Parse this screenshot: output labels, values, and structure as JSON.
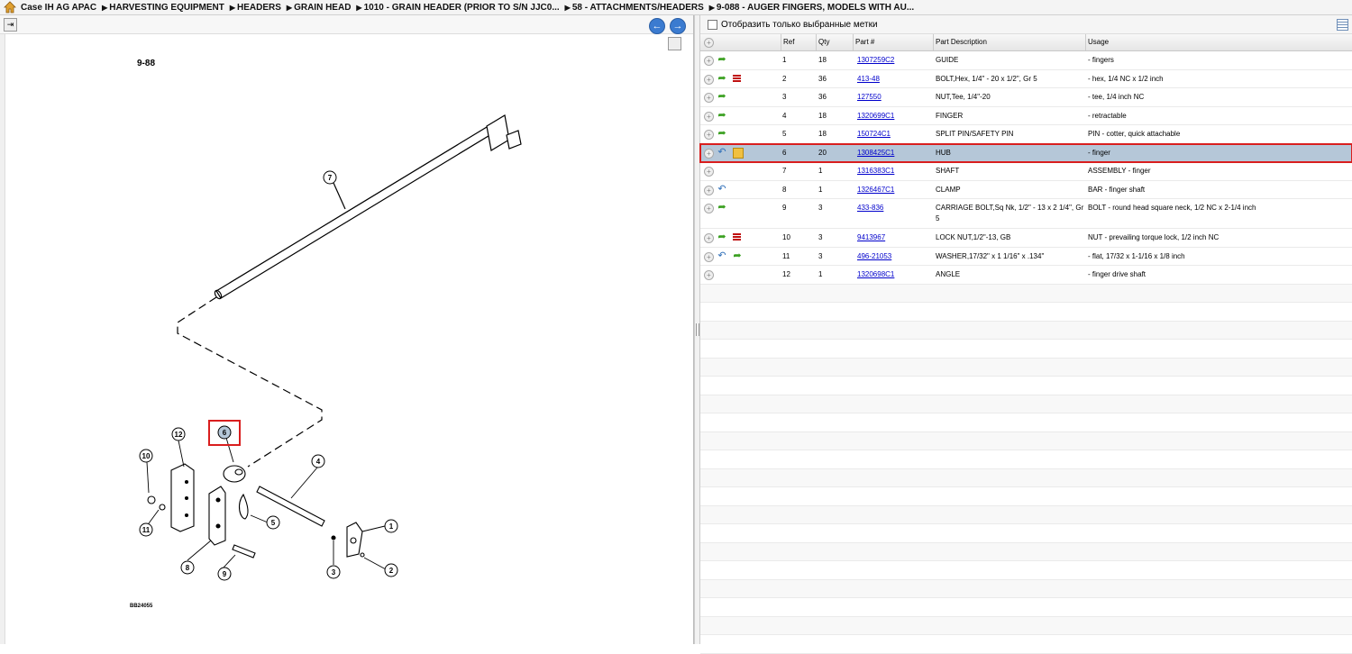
{
  "breadcrumb": {
    "home_icon": "home-icon",
    "items": [
      "Case IH AG APAC",
      "HARVESTING EQUIPMENT",
      "HEADERS",
      "GRAIN HEAD",
      "1010 - GRAIN HEADER (PRIOR TO S/N JJC0...",
      "58 - ATTACHMENTS/HEADERS",
      "9-088 - AUGER FINGERS, MODELS WITH AU..."
    ]
  },
  "diagram": {
    "page_label": "9-88",
    "footer_code": "BB24055",
    "callouts": [
      "1",
      "2",
      "3",
      "4",
      "5",
      "6",
      "7",
      "8",
      "9",
      "10",
      "11",
      "12"
    ],
    "selected_callout": "6",
    "nav": {
      "back": "back-arrow-icon",
      "forward": "forward-arrow-icon"
    }
  },
  "filter": {
    "label": "Отобразить только выбранные метки"
  },
  "table": {
    "headers": {
      "ref": "Ref",
      "qty": "Qty",
      "part": "Part #",
      "desc": "Part Description",
      "usage": "Usage"
    },
    "rows": [
      {
        "ref": "1",
        "qty": "18",
        "part": "1307259C2",
        "desc": "GUIDE",
        "usage": "- fingers",
        "icons": [
          "green-arrow"
        ]
      },
      {
        "ref": "2",
        "qty": "36",
        "part": "413-48",
        "desc": "BOLT,Hex, 1/4\" - 20 x 1/2\", Gr 5",
        "usage": "- hex, 1/4 NC x 1/2 inch",
        "icons": [
          "green-arrow",
          "red-list"
        ]
      },
      {
        "ref": "3",
        "qty": "36",
        "part": "127550",
        "desc": "NUT,Tee, 1/4\"-20",
        "usage": "- tee, 1/4 inch NC",
        "icons": [
          "green-arrow"
        ]
      },
      {
        "ref": "4",
        "qty": "18",
        "part": "1320699C1",
        "desc": "FINGER",
        "usage": "- retractable",
        "icons": [
          "green-arrow"
        ]
      },
      {
        "ref": "5",
        "qty": "18",
        "part": "150724C1",
        "desc": "SPLIT PIN/SAFETY PIN",
        "usage": "PIN - cotter, quick attachable",
        "icons": [
          "green-arrow"
        ]
      },
      {
        "ref": "6",
        "qty": "20",
        "part": "1308425C1",
        "desc": "HUB",
        "usage": "- finger",
        "icons": [
          "blue-arrow",
          "box"
        ],
        "selected": true
      },
      {
        "ref": "7",
        "qty": "1",
        "part": "1316383C1",
        "desc": "SHAFT",
        "usage": "ASSEMBLY - finger",
        "icons": []
      },
      {
        "ref": "8",
        "qty": "1",
        "part": "1326467C1",
        "desc": "CLAMP",
        "usage": "BAR - finger shaft",
        "icons": [
          "blue-arrow"
        ]
      },
      {
        "ref": "9",
        "qty": "3",
        "part": "433-836",
        "desc": "CARRIAGE BOLT,Sq Nk, 1/2\" - 13 x 2 1/4\", Gr 5",
        "usage": "BOLT - round head square neck, 1/2 NC x 2-1/4 inch",
        "icons": [
          "green-arrow"
        ],
        "tall": true
      },
      {
        "ref": "10",
        "qty": "3",
        "part": "9413967",
        "desc": "LOCK NUT,1/2\"-13, GB",
        "usage": "NUT - prevailing torque lock, 1/2 inch NC",
        "icons": [
          "green-arrow",
          "red-list"
        ]
      },
      {
        "ref": "11",
        "qty": "3",
        "part": "496-21053",
        "desc": "WASHER,17/32\" x 1 1/16\" x .134\"",
        "usage": "- flat, 17/32 x 1-1/16 x 1/8 inch",
        "icons": [
          "blue-arrow",
          "green-arrow"
        ]
      },
      {
        "ref": "12",
        "qty": "1",
        "part": "1320698C1",
        "desc": "ANGLE",
        "usage": "- finger drive shaft",
        "icons": []
      }
    ]
  },
  "colors": {
    "selected_row": "#b5c7d8",
    "highlight_border": "#d91e1e",
    "link": "#0000cc"
  }
}
